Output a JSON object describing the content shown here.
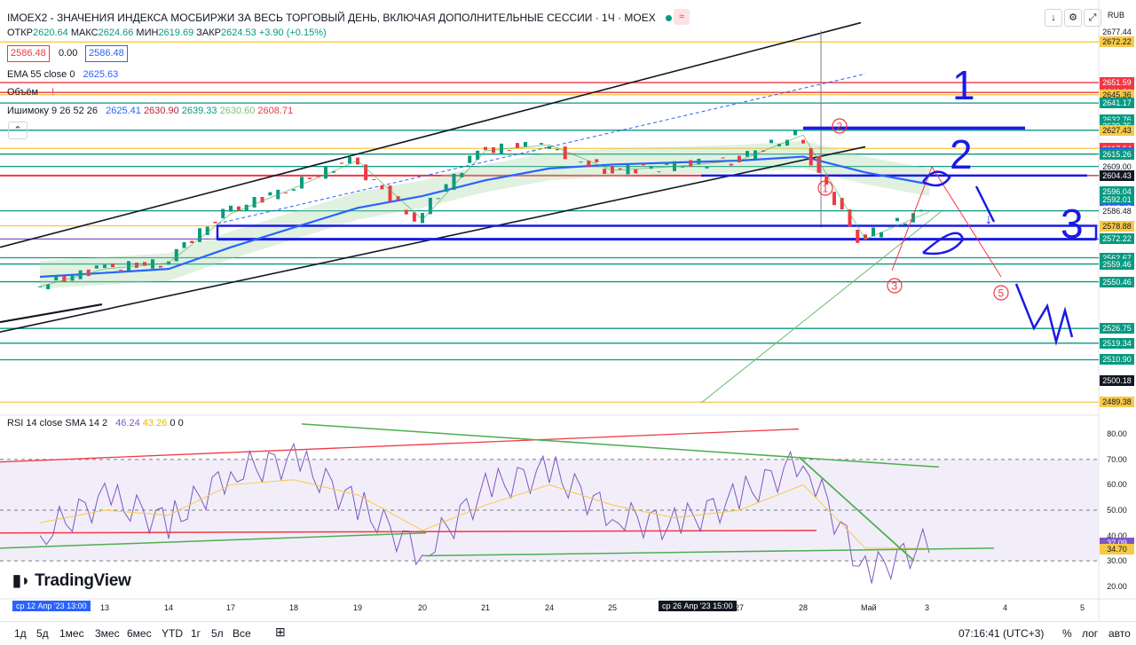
{
  "header": {
    "title": "IMOEX2 - ЗНАЧЕНИЯ ИНДЕКСА МОСБИРЖИ ЗА ВЕСЬ ТОРГОВЫЙ ДЕНЬ, ВКЛЮЧАЯ ДОПОЛНИТЕЛЬНЫЕ СЕССИИ · 1Ч · MOEX",
    "ohlc": {
      "o_label": "ОТКР",
      "o": "2620.64",
      "h_label": "МАКС",
      "h": "2624.66",
      "l_label": "МИН",
      "l": "2619.69",
      "c_label": "ЗАКР",
      "c": "2624.53",
      "change": "+3.90 (+0.15%)"
    },
    "bid": "2586.48",
    "spread": "0.00",
    "ask": "2586.48",
    "currency": "RUB"
  },
  "indicators": {
    "ema": {
      "label": "EMA 55 close 0",
      "value": "2625.63",
      "color": "#2962ff"
    },
    "volume": {
      "label": "Объём",
      "warn": "!"
    },
    "ichimoku": {
      "label": "Ишимоку 9 26 52 26",
      "values": [
        "2625.41",
        "2630.90",
        "2639.33",
        "2630.60",
        "2608.71"
      ],
      "colors": [
        "#2962ff",
        "#b22833",
        "#089981",
        "#a5d6a7",
        "#f23645"
      ]
    },
    "rsi": {
      "label": "RSI 14 close SMA 14 2",
      "values": [
        "46.24",
        "43.26",
        "0",
        "0"
      ],
      "colors": [
        "#7e57c2",
        "#f7c948",
        "#131722",
        "#131722"
      ]
    }
  },
  "price_scale": {
    "labels": [
      "2677.44",
      "2672.22",
      "2651.59",
      "2646.56",
      "2645.36",
      "2641.17",
      "2632.76",
      "2629.75",
      "2627.43",
      "2618.18",
      "2617.94",
      "2616.22",
      "2615.26",
      "2609.00",
      "2604.43",
      "2596.04",
      "2592.01",
      "2587.65",
      "2586.48",
      "2586.48",
      "2578.88",
      "2572.22",
      "2562.67",
      "2559.46",
      "2550.46",
      "2526.75",
      "2519.34",
      "2510.90",
      "2500.18",
      "2489.38"
    ]
  },
  "rsi_scale": {
    "labels": [
      "80.00",
      "70.00",
      "60.00",
      "50.00",
      "40.00",
      "30.00",
      "20.00"
    ],
    "current": "37.09",
    "sma": "34.70"
  },
  "time_axis": {
    "labels": [
      "13",
      "14",
      "17",
      "18",
      "19",
      "20",
      "21",
      "24",
      "25",
      "27",
      "28",
      "Май",
      "3",
      "4",
      "5"
    ],
    "start_tag": "ср 12 Апр '23   13:00",
    "cursor_tag": "ср 26 Апр '23   15:00"
  },
  "annotations": {
    "marks": [
      "1",
      "2",
      "3"
    ],
    "circled": [
      "1",
      "2",
      "3",
      "5"
    ],
    "arrows": "↓"
  },
  "bottom_bar": {
    "ranges": [
      "1д",
      "5д",
      "1мес",
      "3мес",
      "6мес",
      "YTD",
      "1г",
      "5л",
      "Все"
    ],
    "time": "07:16:41 (UTC+3)",
    "percent": "%",
    "log": "лог",
    "auto": "авто"
  },
  "brand": "TradingView",
  "chart_data": {
    "type": "line",
    "title": "IMOEX2 1Ч",
    "xlabel": "",
    "ylabel": "",
    "ylim": [
      2485,
      2680
    ],
    "x": [
      "Apr12",
      "Apr13",
      "Apr14",
      "Apr17",
      "Apr18",
      "Apr19",
      "Apr20",
      "Apr21",
      "Apr24",
      "Apr25",
      "Apr26",
      "Apr27",
      "Apr28",
      "May2",
      "May3"
    ],
    "series": [
      {
        "name": "Close",
        "values": [
          2548,
          2557,
          2560,
          2585,
          2598,
          2612,
          2582,
          2617,
          2620,
          2607,
          2609,
          2612,
          2625,
          2572,
          2586
        ]
      },
      {
        "name": "EMA 55",
        "values": [
          2553,
          2555,
          2557,
          2568,
          2578,
          2588,
          2594,
          2602,
          2608,
          2610,
          2611,
          2612,
          2614,
          2606,
          2600
        ]
      }
    ],
    "rsi": {
      "ylim": [
        15,
        85
      ],
      "values": [
        40,
        55,
        45,
        65,
        70,
        52,
        33,
        58,
        66,
        48,
        44,
        55,
        70,
        25,
        37
      ],
      "sma": [
        45,
        50,
        48,
        60,
        62,
        56,
        42,
        52,
        60,
        52,
        47,
        50,
        60,
        35,
        35
      ]
    }
  }
}
